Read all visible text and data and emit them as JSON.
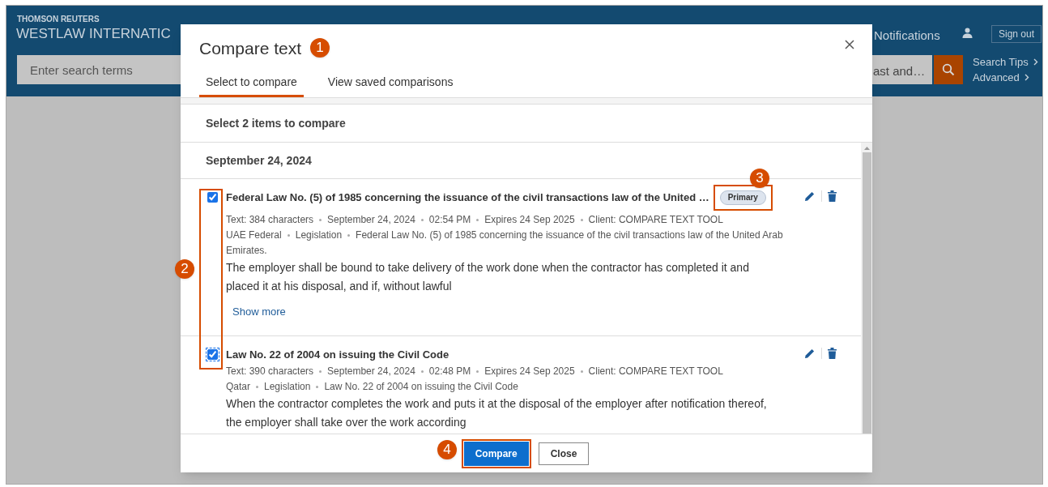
{
  "header": {
    "brand_small": "THOMSON REUTERS",
    "brand": "WESTLAW INTERNATIC",
    "search": {
      "placeholder": "Enter search terms",
      "scope": "ast and…"
    },
    "notifications": "Notifications",
    "sign_out": "Sign out",
    "links": [
      "Search Tips",
      "Advanced"
    ]
  },
  "dialog": {
    "title": "Compare text",
    "tabs": [
      {
        "label": "Select to compare",
        "selected": true
      },
      {
        "label": "View saved comparisons",
        "selected": false
      }
    ],
    "instruction": "Select 2 items to compare",
    "group_date": "September 24, 2024",
    "items": [
      {
        "title": "Federal Law No. (5) of 1985 concerning the issuance of the civil transactions law of the United …",
        "checked": true,
        "focused": false,
        "badge": "Primary",
        "meta": [
          "Text: 384 characters",
          "September 24, 2024",
          "02:54 PM",
          "Expires 24 Sep 2025",
          "Client: COMPARE TEXT TOOL"
        ],
        "source": [
          "UAE Federal",
          "Legislation",
          "Federal Law No. (5) of 1985 concerning the issuance of the civil transactions law of the United Arab Emirates."
        ],
        "excerpt": "The employer shall be bound to take delivery of the work done when the contractor has completed it and placed it at his disposal, and if, without lawful",
        "show_more": "Show more"
      },
      {
        "title": "Law No. 22 of 2004 on issuing the Civil Code",
        "checked": true,
        "focused": true,
        "meta": [
          "Text: 390 characters",
          "September 24, 2024",
          "02:48 PM",
          "Expires 24 Sep 2025",
          "Client: COMPARE TEXT TOOL"
        ],
        "source": [
          "Qatar",
          "Legislation",
          "Law No. 22 of 2004 on issuing the Civil Code"
        ],
        "excerpt": "When the contractor completes the work and puts it at the disposal of the employer after notification thereof, the employer shall take over the work according"
      }
    ],
    "buttons": [
      {
        "label": "Compare",
        "kind": "primary"
      },
      {
        "label": "Close",
        "kind": "secondary"
      }
    ]
  },
  "callouts": [
    "1",
    "2",
    "3",
    "4"
  ]
}
